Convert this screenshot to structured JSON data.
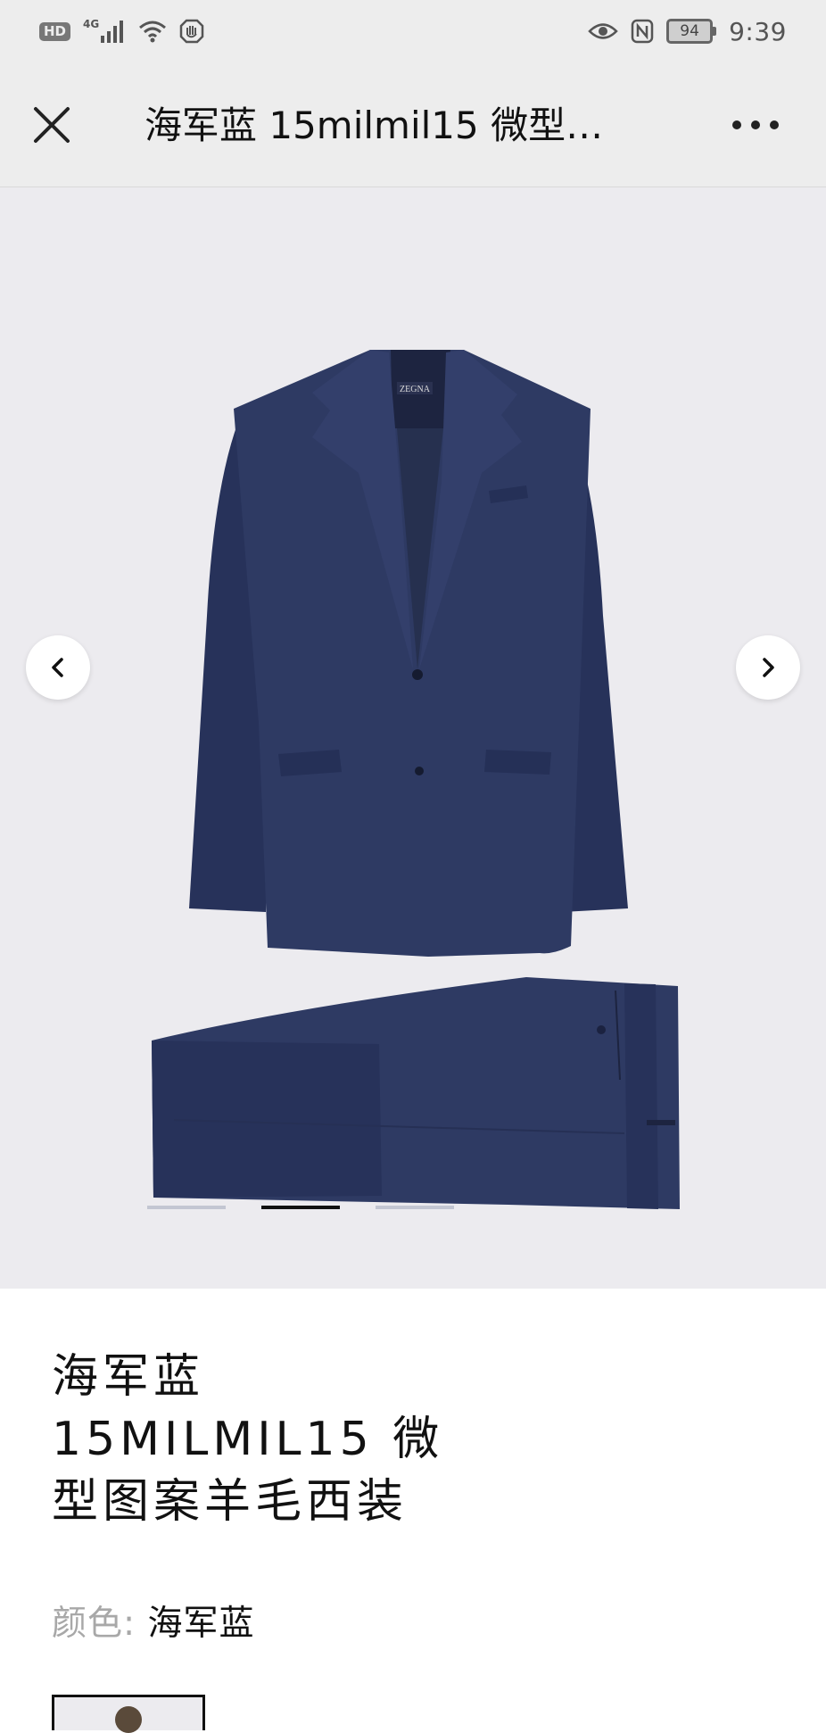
{
  "status_bar": {
    "hd_label": "HD",
    "network_label": "4G",
    "battery_level": "94",
    "time": "9:39",
    "icons": [
      "hd-icon",
      "signal-icon",
      "wifi-icon",
      "hand-icon",
      "eye-icon",
      "nfc-icon",
      "battery-icon"
    ]
  },
  "header": {
    "title": "海军蓝 15milmil15 微型…",
    "close_icon": "close-icon",
    "more_icon": "more-icon"
  },
  "gallery": {
    "prev_icon": "chevron-left-icon",
    "next_icon": "chevron-right-icon",
    "brand_label": "ZEGNA",
    "indicator_count": 3,
    "active_indicator": 2,
    "suit_color": "#2e3a63",
    "background_color": "#ecebef"
  },
  "product": {
    "name_line1": "海军蓝",
    "name_line2": "15MILMIL15 微",
    "name_line3": "型图案羊毛西装",
    "color_label": "颜色:",
    "color_value": "海军蓝"
  }
}
